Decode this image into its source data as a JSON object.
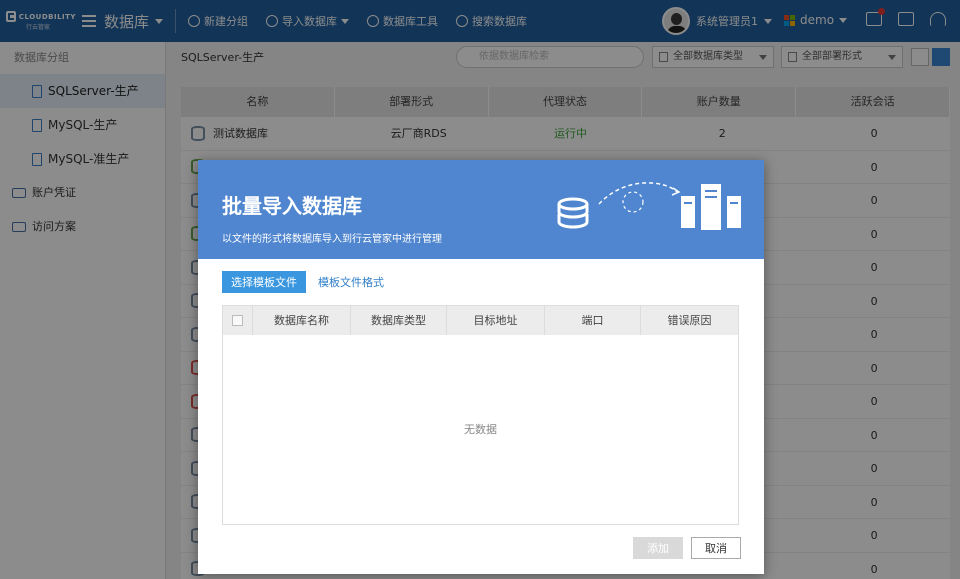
{
  "topbar": {
    "logo_text": "CLOUDBILITY",
    "logo_subtext": "行云管家",
    "module_title": "数据库",
    "tools": [
      "新建分组",
      "导入数据库",
      "数据库工具",
      "搜索数据库"
    ],
    "user_name": "系统管理员1",
    "tenant": "demo"
  },
  "sidebar": {
    "section_title": "数据库分组",
    "groups": [
      "SQLServer-生产",
      "MySQL-生产",
      "MySQL-准生产"
    ],
    "active_group": "SQLServer-生产",
    "links": [
      "账户凭证",
      "访问方案"
    ]
  },
  "content": {
    "breadcrumb": "SQLServer-生产",
    "search_placeholder": "依据数据库检索",
    "filter_type": "全部数据库类型",
    "filter_deploy": "全部部署形式"
  },
  "table": {
    "columns": [
      "名称",
      "部署形式",
      "代理状态",
      "账户数量",
      "活跃会话"
    ],
    "rows": [
      {
        "name": "测试数据库",
        "deploy": "云厂商RDS",
        "status": "运行中",
        "accounts": "2",
        "sessions": "0"
      },
      {
        "name": "",
        "deploy": "",
        "status": "",
        "accounts": "",
        "sessions": "0"
      },
      {
        "name": "",
        "deploy": "",
        "status": "",
        "accounts": "",
        "sessions": "0"
      },
      {
        "name": "",
        "deploy": "",
        "status": "",
        "accounts": "",
        "sessions": "0"
      },
      {
        "name": "",
        "deploy": "",
        "status": "",
        "accounts": "",
        "sessions": "0"
      },
      {
        "name": "",
        "deploy": "",
        "status": "",
        "accounts": "",
        "sessions": "0"
      },
      {
        "name": "",
        "deploy": "",
        "status": "",
        "accounts": "",
        "sessions": "0"
      },
      {
        "name": "",
        "deploy": "",
        "status": "",
        "accounts": "",
        "sessions": "0"
      },
      {
        "name": "",
        "deploy": "",
        "status": "",
        "accounts": "",
        "sessions": "0"
      },
      {
        "name": "",
        "deploy": "",
        "status": "",
        "accounts": "",
        "sessions": "0"
      },
      {
        "name": "",
        "deploy": "",
        "status": "",
        "accounts": "",
        "sessions": "0"
      },
      {
        "name": "",
        "deploy": "",
        "status": "",
        "accounts": "",
        "sessions": "0"
      },
      {
        "name": "",
        "deploy": "",
        "status": "",
        "accounts": "",
        "sessions": "0"
      },
      {
        "name": "",
        "deploy": "",
        "status": "",
        "accounts": "",
        "sessions": "0"
      }
    ]
  },
  "modal": {
    "title": "批量导入数据库",
    "subtitle": "以文件的形式将数据库导入到行云管家中进行管理",
    "select_file": "选择模板文件",
    "template_format": "模板文件格式",
    "columns": [
      "数据库名称",
      "数据库类型",
      "目标地址",
      "端口",
      "错误原因"
    ],
    "empty_text": "无数据",
    "add_label": "添加",
    "cancel_label": "取消"
  },
  "colors": {
    "topbar": "#1f5f9e",
    "modal_header": "#4f86cf",
    "primary": "#3a96de",
    "running": "#3aa53a"
  }
}
